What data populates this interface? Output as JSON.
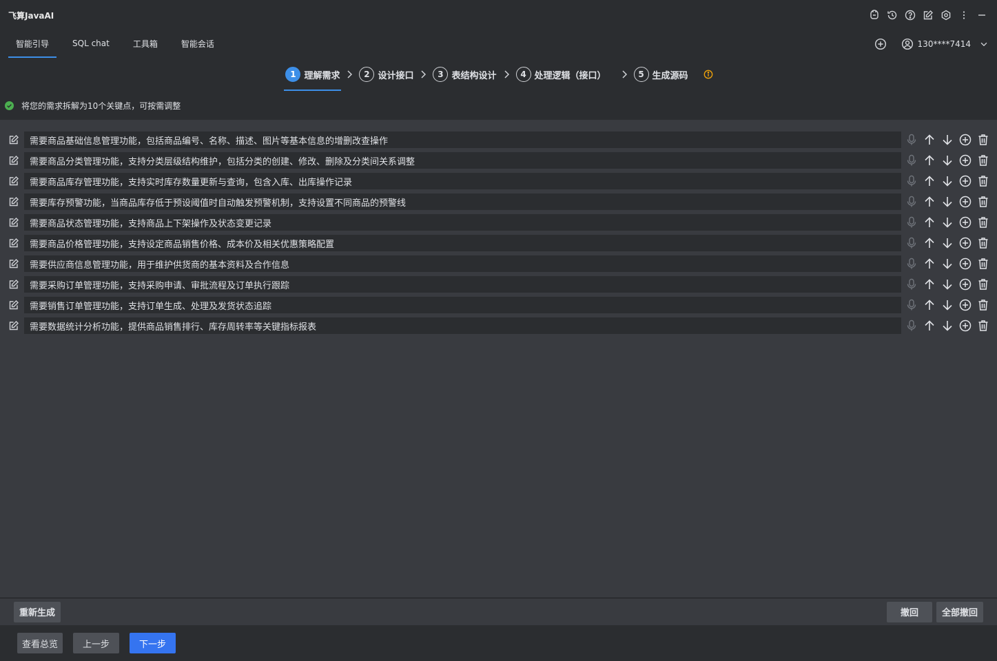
{
  "app": {
    "title": "飞算JavaAI"
  },
  "tabs": [
    {
      "label": "智能引导",
      "active": true
    },
    {
      "label": "SQL chat",
      "active": false
    },
    {
      "label": "工具箱",
      "active": false
    },
    {
      "label": "智能会话",
      "active": false
    }
  ],
  "user": {
    "name": "130****7414"
  },
  "steps": [
    {
      "num": "1",
      "label": "理解需求",
      "active": true
    },
    {
      "num": "2",
      "label": "设计接口",
      "active": false
    },
    {
      "num": "3",
      "label": "表结构设计",
      "active": false
    },
    {
      "num": "4",
      "label": "处理逻辑（接口）",
      "active": false
    },
    {
      "num": "5",
      "label": "生成源码",
      "active": false
    }
  ],
  "notice": {
    "text": "将您的需求拆解为10个关键点，可按需调整"
  },
  "requirements": [
    "需要商品基础信息管理功能，包括商品编号、名称、描述、图片等基本信息的增删改查操作",
    "需要商品分类管理功能，支持分类层级结构维护，包括分类的创建、修改、删除及分类间关系调整",
    "需要商品库存管理功能，支持实时库存数量更新与查询，包含入库、出库操作记录",
    "需要库存预警功能，当商品库存低于预设阈值时自动触发预警机制，支持设置不同商品的预警线",
    "需要商品状态管理功能，支持商品上下架操作及状态变更记录",
    "需要商品价格管理功能，支持设定商品销售价格、成本价及相关优惠策略配置",
    "需要供应商信息管理功能，用于维护供货商的基本资料及合作信息",
    "需要采购订单管理功能，支持采购申请、审批流程及订单执行跟踪",
    "需要销售订单管理功能，支持订单生成、处理及发货状态追踪",
    "需要数据统计分析功能，提供商品销售排行、库存周转率等关键指标报表"
  ],
  "actions": {
    "regenerate": "重新生成",
    "undo": "撤回",
    "undo_all": "全部撤回"
  },
  "footer": {
    "overview": "查看总览",
    "prev": "上一步",
    "next": "下一步"
  },
  "colors": {
    "accent": "#3d8fe8",
    "primary_button": "#3574f0",
    "success": "#4caf50",
    "warning": "#f0a30a"
  },
  "icons": {
    "titlebar": [
      "plugin-icon",
      "history-icon",
      "help-icon",
      "edit-icon",
      "settings-icon",
      "more-icon",
      "minimize-icon"
    ],
    "row": [
      "microphone-icon",
      "arrow-up-icon",
      "arrow-down-icon",
      "add-circle-icon",
      "trash-icon"
    ]
  }
}
